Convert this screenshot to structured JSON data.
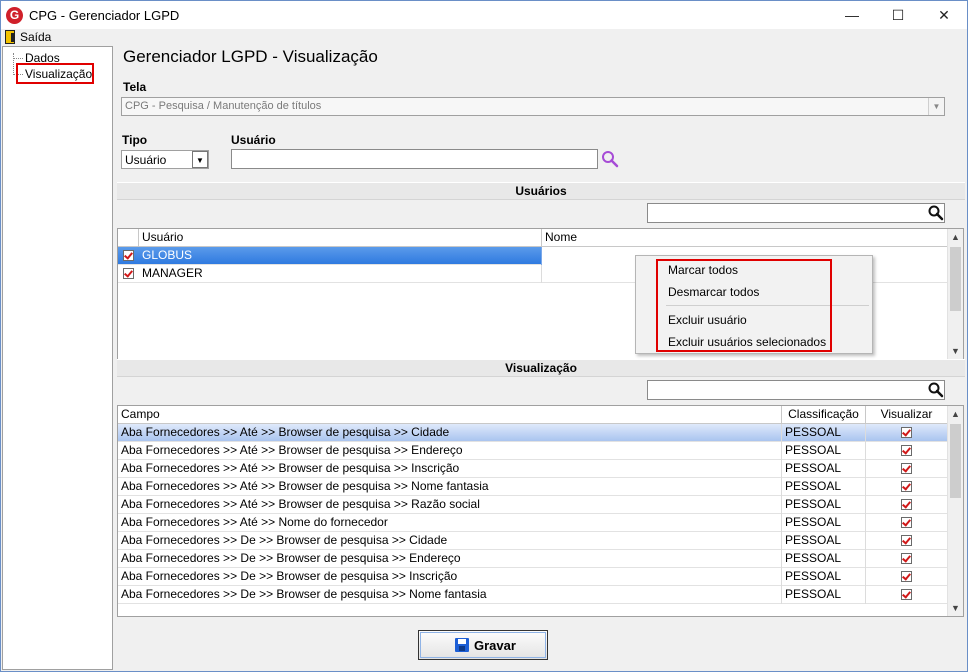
{
  "window": {
    "title": "CPG - Gerenciador LGPD",
    "minimize": "—",
    "maximize": "☐",
    "close": "✕"
  },
  "menu": {
    "exit_label": "Saída"
  },
  "tree": {
    "items": [
      {
        "label": "Dados"
      },
      {
        "label": "Visualização"
      }
    ]
  },
  "page_title": "Gerenciador LGPD - Visualização",
  "tela": {
    "label": "Tela",
    "value": "CPG - Pesquisa / Manutenção de títulos"
  },
  "tipo": {
    "label": "Tipo",
    "value": "Usuário"
  },
  "usuario": {
    "label": "Usuário",
    "value": ""
  },
  "users_section": {
    "title": "Usuários",
    "search_value": "",
    "columns": [
      "Usuário",
      "Nome"
    ],
    "rows": [
      {
        "usuario": "GLOBUS",
        "nome": "",
        "checked": true,
        "selected": true
      },
      {
        "usuario": "MANAGER",
        "nome": "",
        "checked": true,
        "selected": false
      }
    ]
  },
  "context_menu": {
    "items": [
      "Marcar todos",
      "Desmarcar todos",
      "Excluir usuário",
      "Excluir usuários selecionados"
    ]
  },
  "view_section": {
    "title": "Visualização",
    "search_value": "",
    "columns": [
      "Campo",
      "Classificação",
      "Visualizar"
    ],
    "rows": [
      {
        "campo": "Aba Fornecedores >> Até >> Browser de pesquisa >> Cidade",
        "classificacao": "PESSOAL",
        "visualizar": true
      },
      {
        "campo": "Aba Fornecedores >> Até >> Browser de pesquisa >> Endereço",
        "classificacao": "PESSOAL",
        "visualizar": true
      },
      {
        "campo": "Aba Fornecedores >> Até >> Browser de pesquisa >> Inscrição",
        "classificacao": "PESSOAL",
        "visualizar": true
      },
      {
        "campo": "Aba Fornecedores >> Até >> Browser de pesquisa >> Nome fantasia",
        "classificacao": "PESSOAL",
        "visualizar": true
      },
      {
        "campo": "Aba Fornecedores >> Até >> Browser de pesquisa >> Razão social",
        "classificacao": "PESSOAL",
        "visualizar": true
      },
      {
        "campo": "Aba Fornecedores >> Até >> Nome do fornecedor",
        "classificacao": "PESSOAL",
        "visualizar": true
      },
      {
        "campo": "Aba Fornecedores >> De >> Browser de pesquisa >> Cidade",
        "classificacao": "PESSOAL",
        "visualizar": true
      },
      {
        "campo": "Aba Fornecedores >> De >> Browser de pesquisa >> Endereço",
        "classificacao": "PESSOAL",
        "visualizar": true
      },
      {
        "campo": "Aba Fornecedores >> De >> Browser de pesquisa >> Inscrição",
        "classificacao": "PESSOAL",
        "visualizar": true
      },
      {
        "campo": "Aba Fornecedores >> De >> Browser de pesquisa >> Nome fantasia",
        "classificacao": "PESSOAL",
        "visualizar": true
      }
    ]
  },
  "save_button": {
    "label": "Gravar"
  },
  "colors": {
    "accent": "#2f7ae0",
    "highlight_box": "#e00000",
    "check": "#d01818",
    "search_icon": "#a64bd6"
  }
}
